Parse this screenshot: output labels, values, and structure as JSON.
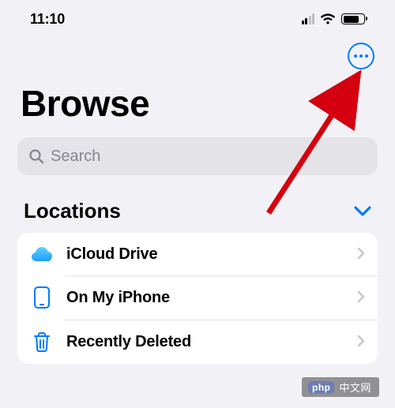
{
  "status": {
    "time": "11:10"
  },
  "toolbar": {
    "more_name": "more-options-button"
  },
  "page": {
    "title": "Browse"
  },
  "search": {
    "placeholder": "Search"
  },
  "section": {
    "title": "Locations"
  },
  "locations": {
    "items": [
      {
        "label": "iCloud Drive"
      },
      {
        "label": "On My iPhone"
      },
      {
        "label": "Recently Deleted"
      }
    ]
  },
  "watermark": {
    "brand": "php",
    "text": "中文网"
  },
  "colors": {
    "accent": "#007aff"
  }
}
